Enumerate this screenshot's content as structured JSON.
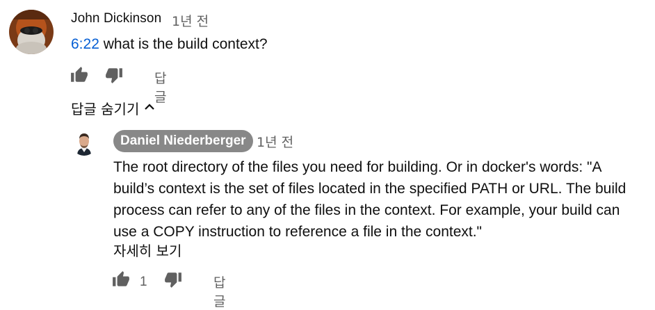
{
  "top_comment": {
    "author": "John Dickinson",
    "time": "1년 전",
    "timestamp_link": "6:22",
    "text": " what is the build context?",
    "reply_label": "답글"
  },
  "hide_replies_label": "답글 숨기기",
  "reply": {
    "author": "Daniel Niederberger",
    "time": "1년 전",
    "lines": [
      "The root directory of the files you need for building. Or in docker's words: \"A",
      "build’s context is the set of files located in the specified PATH or URL. The build",
      "process can refer to any of the files in the context. For example, your build can",
      "use a COPY instruction to reference a file in the context.\""
    ],
    "read_more": "자세히 보기",
    "like_count": "1",
    "reply_label": "답글"
  },
  "icons": {
    "like": "thumbs-up-icon",
    "dislike": "thumbs-down-icon",
    "chevron": "chevron-up-icon"
  },
  "colors": {
    "link": "#065fd4",
    "secondary_text": "#606060",
    "author_chip_bg": "#888888"
  }
}
